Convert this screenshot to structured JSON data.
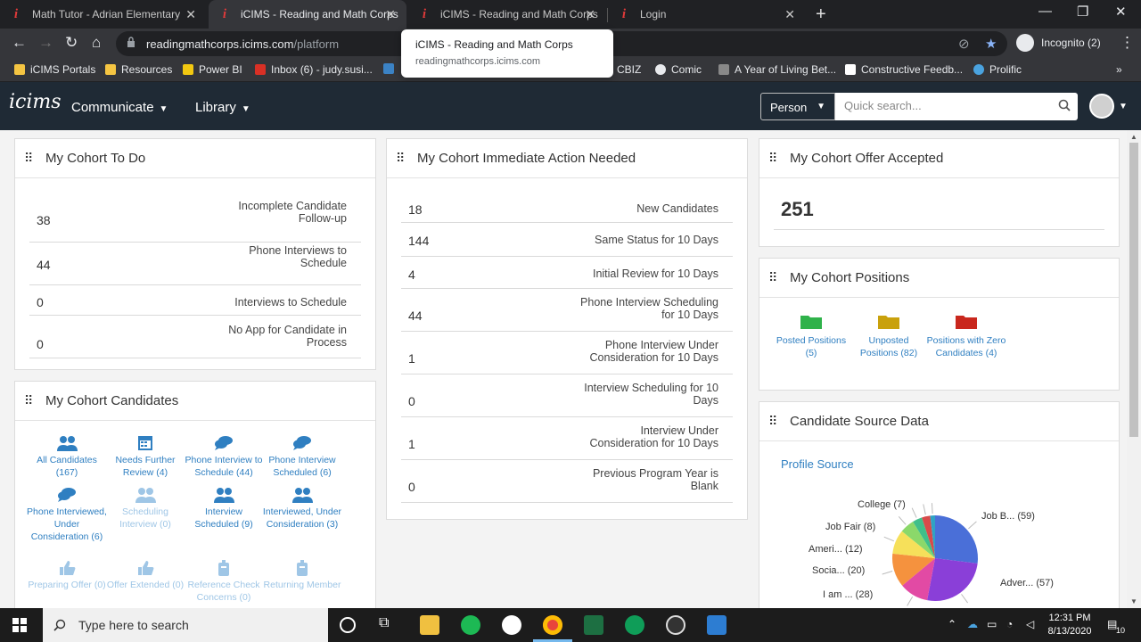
{
  "browser": {
    "tabs": [
      {
        "title": "Math Tutor - Adrian Elementary",
        "active": false
      },
      {
        "title": "iCIMS - Reading and Math Corps",
        "active": true
      },
      {
        "title": "iCIMS - Reading and Math Corps",
        "active": false
      },
      {
        "title": "Login",
        "active": false
      }
    ],
    "url_host": "readingmathcorps.icims.com",
    "url_path": "/platform",
    "incognito_label": "Incognito (2)",
    "tooltip_title": "iCIMS - Reading and Math Corps",
    "tooltip_url": "readingmathcorps.icims.com",
    "bookmarks": [
      {
        "label": "iCIMS Portals",
        "color": "#f5c542"
      },
      {
        "label": "Resources",
        "color": "#f5c542"
      },
      {
        "label": "Power BI",
        "color": "#f2c811"
      },
      {
        "label": "Inbox (6) - judy.susi...",
        "color": "#d93025"
      },
      {
        "label": "CBIZ",
        "color": "#3b82c4"
      },
      {
        "label": "Comic",
        "color": "#e8eaed"
      },
      {
        "label": "A Year of Living Bet...",
        "color": "#888888"
      },
      {
        "label": "Constructive Feedb...",
        "color": "#ffffff"
      },
      {
        "label": "Prolific",
        "color": "#4aa3df"
      }
    ]
  },
  "app": {
    "logo": "icims",
    "menu": [
      {
        "label": "Communicate"
      },
      {
        "label": "Library"
      }
    ],
    "search_scope": "Person",
    "search_placeholder": "Quick search..."
  },
  "todo": {
    "title": "My Cohort To Do",
    "rows": [
      {
        "value": "38",
        "label": "Incomplete Candidate Follow-up"
      },
      {
        "value": "44",
        "label": "Phone Interviews to Schedule"
      },
      {
        "value": "0",
        "label": "Interviews to Schedule"
      },
      {
        "value": "0",
        "label": "No App for Candidate in Process"
      }
    ]
  },
  "action": {
    "title": "My Cohort Immediate Action Needed",
    "rows": [
      {
        "value": "18",
        "label": "New Candidates"
      },
      {
        "value": "144",
        "label": "Same Status for 10 Days"
      },
      {
        "value": "4",
        "label": "Initial Review for 10 Days"
      },
      {
        "value": "44",
        "label": "Phone Interview Scheduling for 10 Days"
      },
      {
        "value": "1",
        "label": "Phone Interview Under Consideration for 10 Days"
      },
      {
        "value": "0",
        "label": "Interview Scheduling for 10 Days"
      },
      {
        "value": "1",
        "label": "Interview Under Consideration for 10 Days"
      },
      {
        "value": "0",
        "label": "Previous Program Year is Blank"
      }
    ]
  },
  "offer": {
    "title": "My Cohort Offer Accepted",
    "value": "251"
  },
  "positions": {
    "title": "My Cohort Positions",
    "items": [
      {
        "label": "Posted Positions (5)",
        "color": "#2fb24a"
      },
      {
        "label": "Unposted Positions (82)",
        "color": "#c9a10c"
      },
      {
        "label": "Positions with Zero Candidates (4)",
        "color": "#c9271d"
      }
    ]
  },
  "candidates": {
    "title": "My Cohort Candidates",
    "items": [
      {
        "label": "All Candidates (167)",
        "icon": "people-icon",
        "dim": false
      },
      {
        "label": "Needs Further Review (4)",
        "icon": "calendar-icon",
        "dim": false
      },
      {
        "label": "Phone Interview to Schedule (44)",
        "icon": "chat-icon",
        "dim": false
      },
      {
        "label": "Phone Interview Scheduled (6)",
        "icon": "chat-icon",
        "dim": false
      },
      {
        "label": "Phone Interviewed, Under Consideration (6)",
        "icon": "chat-icon",
        "dim": false
      },
      {
        "label": "Scheduling Interview (0)",
        "icon": "people-icon",
        "dim": true
      },
      {
        "label": "Interview Scheduled (9)",
        "icon": "people-icon",
        "dim": false
      },
      {
        "label": "Interviewed, Under Consideration (3)",
        "icon": "people-icon",
        "dim": false
      },
      {
        "label": "Preparing Offer (0)",
        "icon": "thumbs-up-icon",
        "dim": true
      },
      {
        "label": "Offer Extended (0)",
        "icon": "thumbs-up-icon",
        "dim": true
      },
      {
        "label": "Reference Check Concerns (0)",
        "icon": "badge-icon",
        "dim": true
      },
      {
        "label": "Returning Member",
        "icon": "badge-icon",
        "dim": true
      }
    ]
  },
  "source": {
    "title": "Candidate Source Data",
    "link": "Profile Source"
  },
  "chart_data": {
    "type": "pie",
    "title": "",
    "slices": [
      {
        "label": "Job B...",
        "value": 59,
        "color": "#4a6fd8"
      },
      {
        "label": "Adver...",
        "value": 57,
        "color": "#8a3fd8"
      },
      {
        "label": "",
        "value": 24,
        "color": "#e24aa4"
      },
      {
        "label": "I am ...",
        "value": 28,
        "color": "#f5923e"
      },
      {
        "label": "Socia...",
        "value": 20,
        "color": "#f6e05a"
      },
      {
        "label": "Ameri...",
        "value": 12,
        "color": "#8bd86a"
      },
      {
        "label": "Job Fair",
        "value": 8,
        "color": "#3fbf8a"
      },
      {
        "label": "College",
        "value": 7,
        "color": "#d84a4a"
      },
      {
        "label": "",
        "value": 4,
        "color": "#2fa3c4"
      }
    ],
    "printed_labels": [
      "Job B... (59)",
      "Adver... (57)",
      "I am ... (28)",
      "Socia... (20)",
      "Ameri... (12)",
      "Job Fair (8)",
      "College (7)"
    ]
  },
  "taskbar": {
    "search_text": "Type here to search",
    "time": "12:31 PM",
    "date": "8/13/2020",
    "notifications": "10"
  }
}
